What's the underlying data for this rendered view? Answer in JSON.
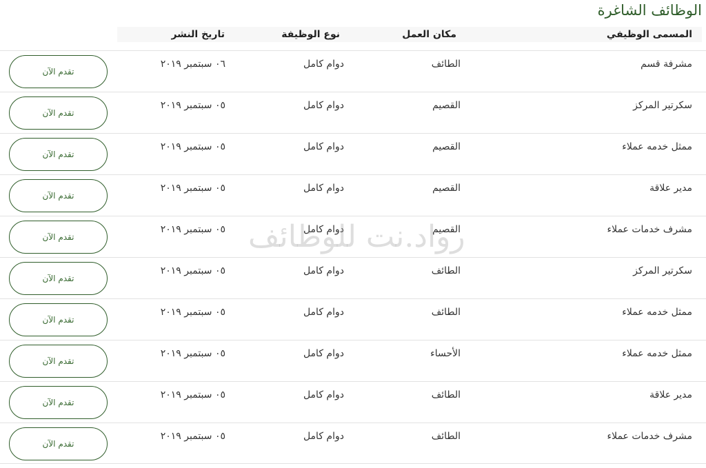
{
  "section_title": "الوظائف الشاغرة",
  "columns": {
    "title": "المسمى الوظيفي",
    "place": "مكان العمل",
    "type": "نوع الوظيفة",
    "date": "تاريخ النشر"
  },
  "apply_label": "تقدم الآن",
  "watermark": "رواد.نت للوظائف",
  "jobs": [
    {
      "title": "مشرفة قسم",
      "place": "الطائف",
      "type": "دوام كامل",
      "date": "٠٦ سبتمبر ٢٠١٩"
    },
    {
      "title": "سكرتير المركز",
      "place": "القصيم",
      "type": "دوام كامل",
      "date": "٠٥ سبتمبر ٢٠١٩"
    },
    {
      "title": "ممثل خدمه عملاء",
      "place": "القصيم",
      "type": "دوام كامل",
      "date": "٠٥ سبتمبر ٢٠١٩"
    },
    {
      "title": "مدير علاقة",
      "place": "القصيم",
      "type": "دوام كامل",
      "date": "٠٥ سبتمبر ٢٠١٩"
    },
    {
      "title": "مشرف خدمات عملاء",
      "place": "القصيم",
      "type": "دوام كامل",
      "date": "٠٥ سبتمبر ٢٠١٩"
    },
    {
      "title": "سكرتير المركز",
      "place": "الطائف",
      "type": "دوام كامل",
      "date": "٠٥ سبتمبر ٢٠١٩"
    },
    {
      "title": "ممثل خدمه عملاء",
      "place": "الطائف",
      "type": "دوام كامل",
      "date": "٠٥ سبتمبر ٢٠١٩"
    },
    {
      "title": "ممثل خدمه عملاء",
      "place": "الأحساء",
      "type": "دوام كامل",
      "date": "٠٥ سبتمبر ٢٠١٩"
    },
    {
      "title": "مدير علاقة",
      "place": "الطائف",
      "type": "دوام كامل",
      "date": "٠٥ سبتمبر ٢٠١٩"
    },
    {
      "title": "مشرف خدمات عملاء",
      "place": "الطائف",
      "type": "دوام كامل",
      "date": "٠٥ سبتمبر ٢٠١٩"
    }
  ]
}
